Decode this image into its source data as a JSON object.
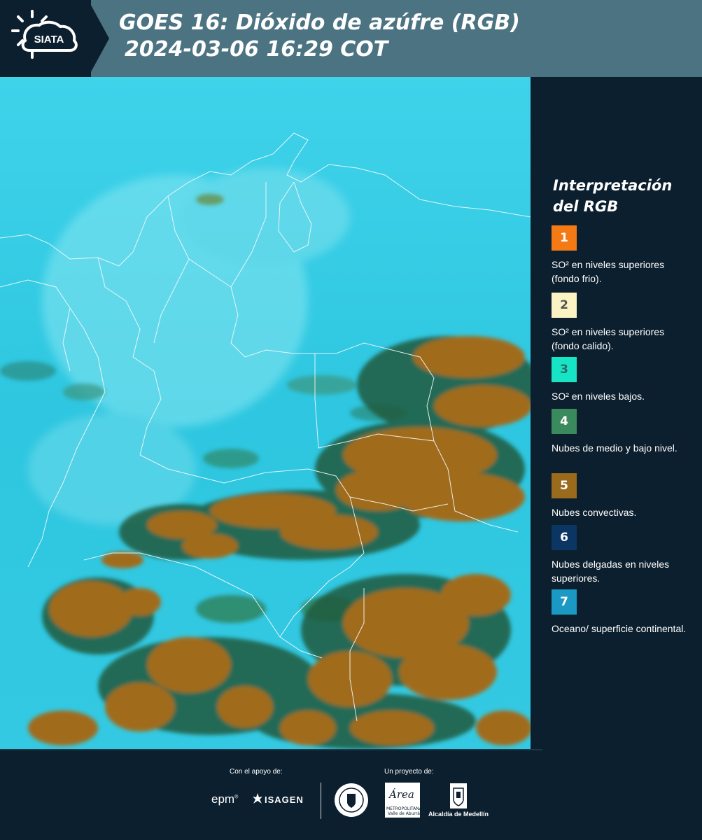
{
  "header": {
    "logo_text": "SIATA",
    "title_line1": "GOES 16: Dióxido de azúfre (RGB)",
    "title_line2": "2024-03-06 16:29 COT"
  },
  "legend": {
    "title_line1": "Interpretación",
    "title_line2": "del RGB",
    "items": [
      {
        "number": "1",
        "text": "SO² en niveles superiores (fondo frio).",
        "color": "#f47a16",
        "num_color": "#ffffff"
      },
      {
        "number": "2",
        "text": "SO² en niveles superiores (fondo calido).",
        "color": "#fbf3c3",
        "num_color": "#555555"
      },
      {
        "number": "3",
        "text": "SO² en niveles bajos.",
        "color": "#17e4c4",
        "num_color": "#2a6a66"
      },
      {
        "number": "4",
        "text": "Nubes de medio y bajo nivel.",
        "color": "#3b8a5e",
        "num_color": "#ffffff"
      },
      {
        "number": "5",
        "text": "Nubes convectivas.",
        "color": "#9a6a1d",
        "num_color": "#ffffff"
      },
      {
        "number": "6",
        "text": "Nubes delgadas en niveles superiores.",
        "color": "#0b3563",
        "num_color": "#ffffff"
      },
      {
        "number": "7",
        "text": "Oceano/ superficie continental.",
        "color": "#1b98c4",
        "num_color": "#ffffff"
      }
    ]
  },
  "footer": {
    "support_label": "Con el apoyo de:",
    "project_label": "Un proyecto de:",
    "sponsor_epm": "epm",
    "sponsor_isagen": "ISAGEN",
    "amva_logo_text": "Área",
    "amva_name": "METROPOLITANA Valle de Aburrá",
    "alcaldia": "Alcaldía de Medellín"
  },
  "colors": {
    "background": "#0c1f2e",
    "header": "#4c7382",
    "surface": "#2fc7e0",
    "convective": "#9a6a1d"
  }
}
